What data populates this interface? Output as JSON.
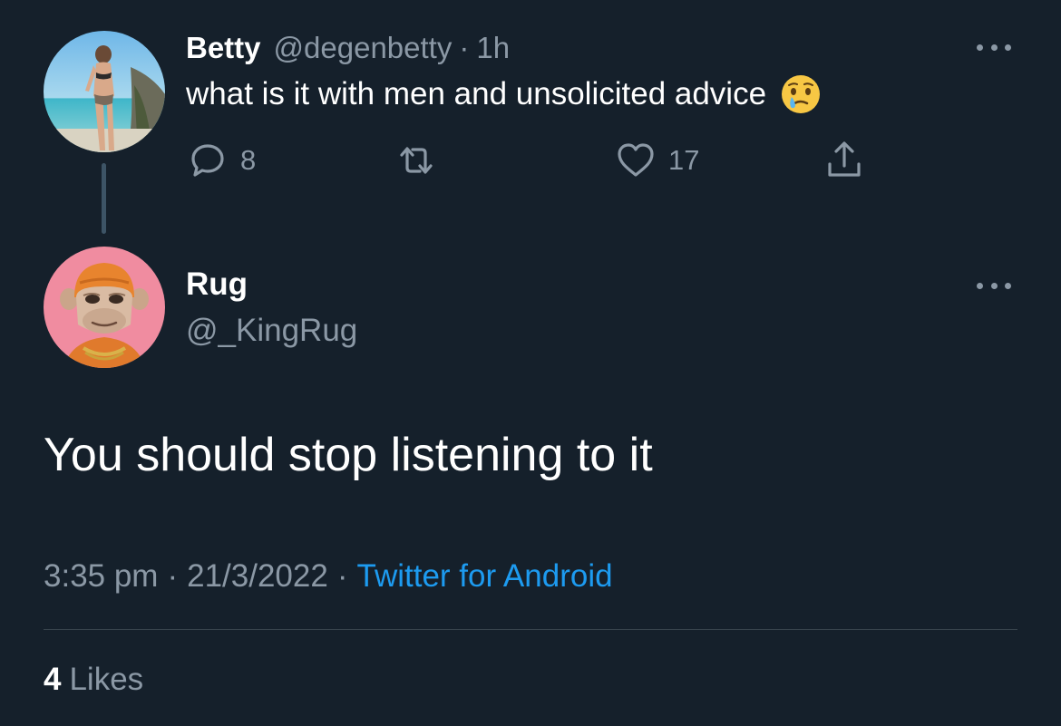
{
  "parent_tweet": {
    "author_name": "Betty",
    "author_handle": "@degenbetty",
    "separator": "·",
    "time_ago": "1h",
    "text": "what is it with men and unsolicited advice",
    "emoji": "face-holding-back-tears",
    "reply_count": "8",
    "retweet_count": "",
    "like_count": "17"
  },
  "reply_tweet": {
    "author_name": "Rug",
    "author_handle": "@_KingRug",
    "text": "You should stop listening to it",
    "time": "3:35 pm",
    "date": "21/3/2022",
    "separator": "·",
    "source": "Twitter for Android",
    "likes_count": "4",
    "likes_label": "Likes"
  },
  "icons": {
    "more": "more-horizontal-icon",
    "reply": "reply-bubble-icon",
    "retweet": "retweet-icon",
    "like": "heart-icon",
    "share": "share-icon"
  },
  "colors": {
    "background": "#15202b",
    "text_primary": "#ffffff",
    "text_secondary": "#8b98a5",
    "link": "#1d9bf0",
    "divider": "#38444d"
  }
}
